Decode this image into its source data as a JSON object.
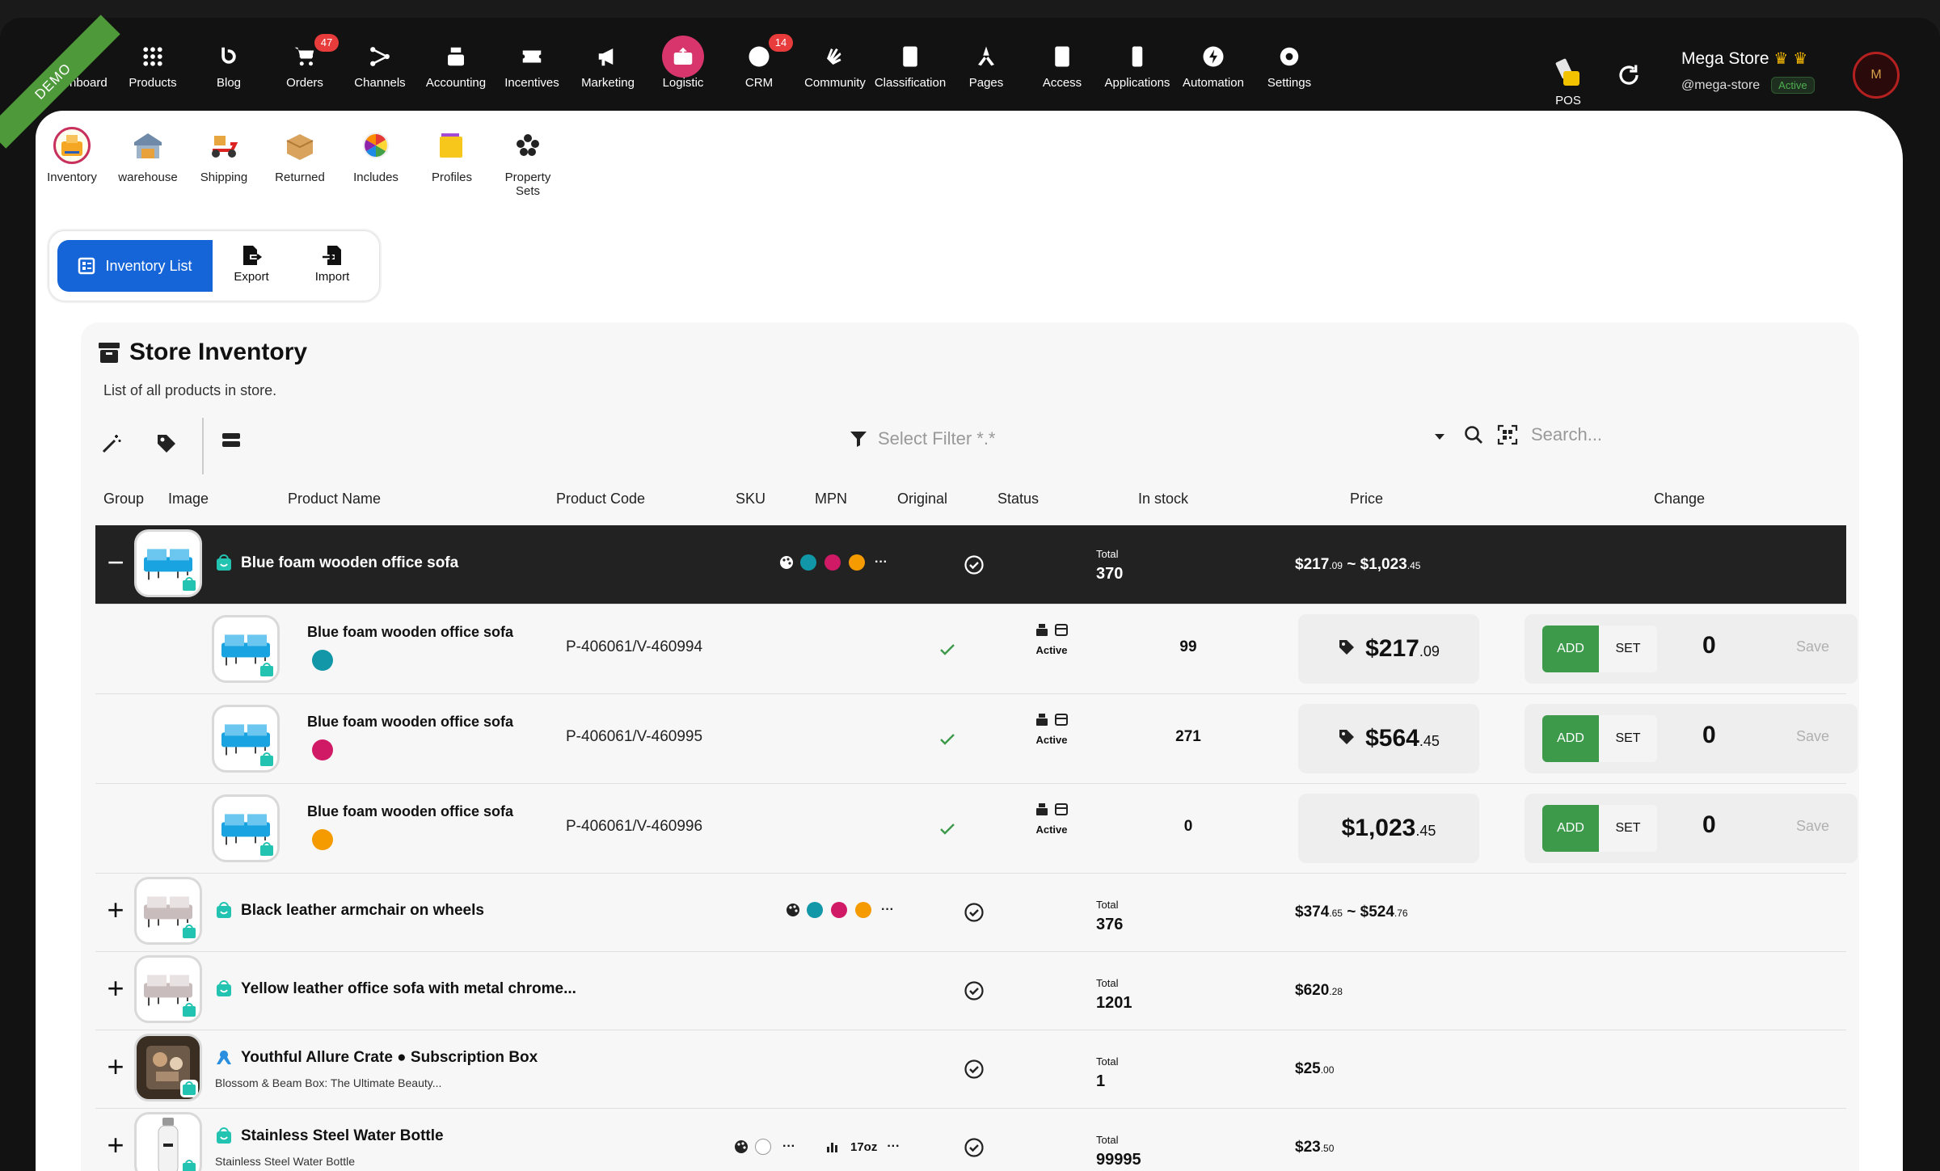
{
  "demo_label": "DEMO",
  "nav": [
    {
      "label": "Dashboard",
      "icon": "dashboard-icon"
    },
    {
      "label": "Products",
      "icon": "grid-icon"
    },
    {
      "label": "Blog",
      "icon": "blog-icon"
    },
    {
      "label": "Orders",
      "icon": "cart-icon",
      "badge": "47"
    },
    {
      "label": "Channels",
      "icon": "channels-icon"
    },
    {
      "label": "Accounting",
      "icon": "calculator-icon"
    },
    {
      "label": "Incentives",
      "icon": "ticket-icon"
    },
    {
      "label": "Marketing",
      "icon": "megaphone-icon"
    },
    {
      "label": "Logistic",
      "icon": "logistic-icon",
      "active": true
    },
    {
      "label": "CRM",
      "icon": "crm-icon",
      "badge": "14"
    },
    {
      "label": "Community",
      "icon": "community-icon"
    },
    {
      "label": "Classification",
      "icon": "book-icon"
    },
    {
      "label": "Pages",
      "icon": "pages-icon"
    },
    {
      "label": "Access",
      "icon": "id-card-icon"
    },
    {
      "label": "Applications",
      "icon": "phone-icon"
    },
    {
      "label": "Automation",
      "icon": "bolt-icon"
    },
    {
      "label": "Settings",
      "icon": "gear-icon"
    }
  ],
  "pos_label": "POS",
  "store": {
    "name": "Mega Store",
    "handle": "@mega-store",
    "status": "Active"
  },
  "subnav": [
    {
      "label": "Inventory",
      "active": true
    },
    {
      "label": "warehouse"
    },
    {
      "label": "Shipping"
    },
    {
      "label": "Returned"
    },
    {
      "label": "Includes"
    },
    {
      "label": "Profiles"
    },
    {
      "label": "Property Sets"
    }
  ],
  "tabs": {
    "inventory_list": "Inventory List",
    "export": "Export",
    "import": "Import"
  },
  "card": {
    "title": "Store Inventory",
    "subtitle": "List of all products in store."
  },
  "filter_placeholder": "Select Filter *.*",
  "search_placeholder": "Search...",
  "columns": [
    "Group",
    "Image",
    "Product Name",
    "Product Code",
    "SKU",
    "MPN",
    "Original",
    "Status",
    "In stock",
    "Price",
    "Change"
  ],
  "colors": {
    "teal": "#1297a8",
    "magenta": "#d01a66",
    "orange": "#f59b00",
    "green": "#3c9a4a",
    "blue": "#1565d8"
  },
  "groups": [
    {
      "toggle": "−",
      "name": "Blue foam wooden office sofa",
      "total_label": "Total",
      "total": "370",
      "price_from": "$217",
      "price_from_cents": ".09",
      "price_sep": " ~ ",
      "price_to": "$1,023",
      "price_to_cents": ".45",
      "more": "···"
    },
    {
      "toggle": "+",
      "name": "Black leather armchair on wheels",
      "total_label": "Total",
      "total": "376",
      "price_from": "$374",
      "price_from_cents": ".65",
      "price_sep": " ~ ",
      "price_to": "$524",
      "price_to_cents": ".76",
      "more": "···"
    },
    {
      "toggle": "+",
      "name": "Yellow leather office sofa with metal chrome...",
      "total_label": "Total",
      "total": "1201",
      "price": "$620",
      "price_cents": ".28"
    },
    {
      "toggle": "+",
      "name": "Youthful Allure Crate ● Subscription Box",
      "sub": "Blossom & Beam Box: The Ultimate Beauty...",
      "total_label": "Total",
      "total": "1",
      "price": "$25",
      "price_cents": ".00"
    },
    {
      "toggle": "+",
      "name": "Stainless Steel Water Bottle",
      "sub": "Stainless Steel Water Bottle",
      "total_label": "Total",
      "total": "99995",
      "price": "$23",
      "price_cents": ".50",
      "size": "17oz",
      "more": "···"
    }
  ],
  "variants": [
    {
      "name": "Blue foam wooden office sofa",
      "color": "#1297a8",
      "code": "P-406061/V-460994",
      "status": "Active",
      "stock": "99",
      "price": "$217",
      "price_cents": ".09",
      "tagged": true,
      "add": "ADD",
      "set": "SET",
      "qty": "0",
      "save": "Save"
    },
    {
      "name": "Blue foam wooden office sofa",
      "color": "#d01a66",
      "code": "P-406061/V-460995",
      "status": "Active",
      "stock": "271",
      "price": "$564",
      "price_cents": ".45",
      "tagged": true,
      "add": "ADD",
      "set": "SET",
      "qty": "0",
      "save": "Save"
    },
    {
      "name": "Blue foam wooden office sofa",
      "color": "#f59b00",
      "code": "P-406061/V-460996",
      "status": "Active",
      "stock": "0",
      "price": "$1,023",
      "price_cents": ".45",
      "tagged": false,
      "add": "ADD",
      "set": "SET",
      "qty": "0",
      "save": "Save"
    }
  ]
}
